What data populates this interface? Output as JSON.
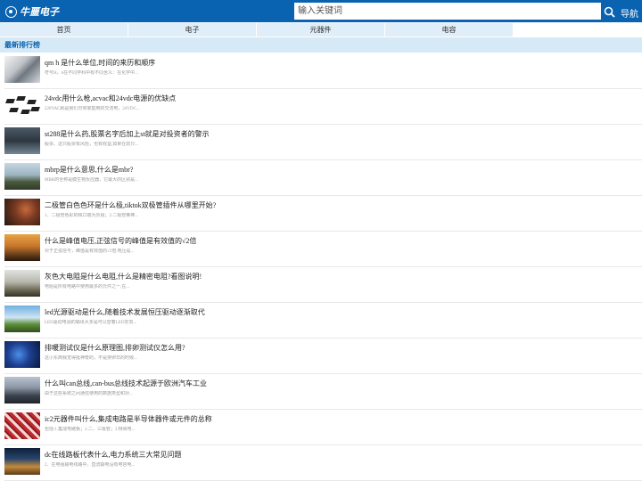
{
  "header": {
    "logo_text": "牛噩电子",
    "search_placeholder": "输入关键词",
    "nav_label": "导航",
    "colors": {
      "primary": "#0a63b0",
      "tab_bg": "#dfeef8"
    }
  },
  "tabs": [
    {
      "label": "首页"
    },
    {
      "label": "电子"
    },
    {
      "label": "元器件"
    },
    {
      "label": "电容"
    }
  ],
  "section": {
    "title": "最新排行榜"
  },
  "articles": [
    {
      "title": "qm h 是什么单位,时间的来历和顺序",
      "desc": "符号H，h在不同学科中有不同含义：在化学中..."
    },
    {
      "title": "24vdc用什么枪,acvac和24vdc电源的优缺点",
      "desc": "220VAC就是我们日常家庭用的交流电，24VDC..."
    },
    {
      "title": "st288是什么药,股票名字后加上st就是对投资者的警示",
      "desc": "股票、这只股票有风险，也有收益,如果在前只..."
    },
    {
      "title": "mbrp是什么意思,什么是mbr?",
      "desc": "MBR的全称是膜生物反应器，它最大的区别是..."
    },
    {
      "title": "二极管白色色环是什么极,tiktok双极管插件从哪里开始?",
      "desc": "1、二极管色彩的缺口端为负极；2.二极管推棒..."
    },
    {
      "title": "什么是峰值电压,正弦信号的峰值是有效值的√2倍",
      "desc": "对于正弦信号，峰值是有效值的√2倍,电压是..."
    },
    {
      "title": "灰色大电阻是什么电阻,什么是精密电阻?看图说明!",
      "desc": "电阻是所有电路中使用最多的元件之一,在..."
    },
    {
      "title": "led光源驱动是什么,随着技术发展恒压驱动逐渐取代",
      "desc": "LED驱动电源的输出大多是可以替着LED定向..."
    },
    {
      "title": "排暖测试仪是什么原理图,排卵测试仪怎么用?",
      "desc": "这小东西我觉得挺神奇的，不是排卵日的时候..."
    },
    {
      "title": "什么叫can总线,can-bus总线技术起源于欧洲汽车工业",
      "desc": "由于这些系统之间通信使用的数据类型和对..."
    },
    {
      "title": "ic2元器件叫什么,集成电路是半导体器件或元件的总称",
      "desc": "包括:1.集成电路板；2.二、三极管；3.特殊电..."
    },
    {
      "title": "dc在线路板代表什么,电力系统三大常见问题",
      "desc": "2、在电组输电线路中，直流输电没有电容电..."
    }
  ]
}
